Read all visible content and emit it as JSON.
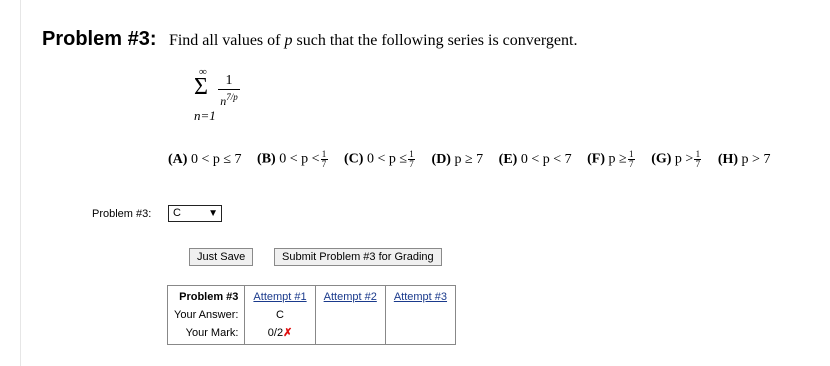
{
  "problem": {
    "label": "Problem #3:",
    "statement_pre": "Find all values of",
    "statement_var": "p",
    "statement_post": "such that the following series is convergent."
  },
  "series": {
    "upper": "∞",
    "sigma": "Σ",
    "lower": "n=1",
    "numerator": "1",
    "denominator_base": "n",
    "denominator_exp": "7/p"
  },
  "choices": [
    {
      "key": "(A)",
      "text": "0 < p ≤ 7"
    },
    {
      "key": "(B)",
      "text": "0 < p <",
      "frac": [
        "1",
        "7"
      ]
    },
    {
      "key": "(C)",
      "text": "0 < p ≤",
      "frac": [
        "1",
        "7"
      ]
    },
    {
      "key": "(D)",
      "text": "p ≥ 7"
    },
    {
      "key": "(E)",
      "text": "0 < p < 7"
    },
    {
      "key": "(F)",
      "text": "p ≥",
      "frac": [
        "1",
        "7"
      ]
    },
    {
      "key": "(G)",
      "text": "p >",
      "frac": [
        "1",
        "7"
      ]
    },
    {
      "key": "(H)",
      "text": "p > 7"
    }
  ],
  "answer": {
    "label": "Problem #3:",
    "selected": "C"
  },
  "buttons": {
    "save": "Just Save",
    "submit": "Submit Problem #3 for Grading"
  },
  "results": {
    "header": "Problem #3",
    "attempts": [
      "Attempt #1",
      "Attempt #2",
      "Attempt #3"
    ],
    "your_answer_label": "Your Answer:",
    "your_mark_label": "Your Mark:",
    "answer_values": [
      "C",
      "",
      ""
    ],
    "mark_values": [
      "0/2",
      "",
      ""
    ],
    "mark_symbol": "✗"
  }
}
